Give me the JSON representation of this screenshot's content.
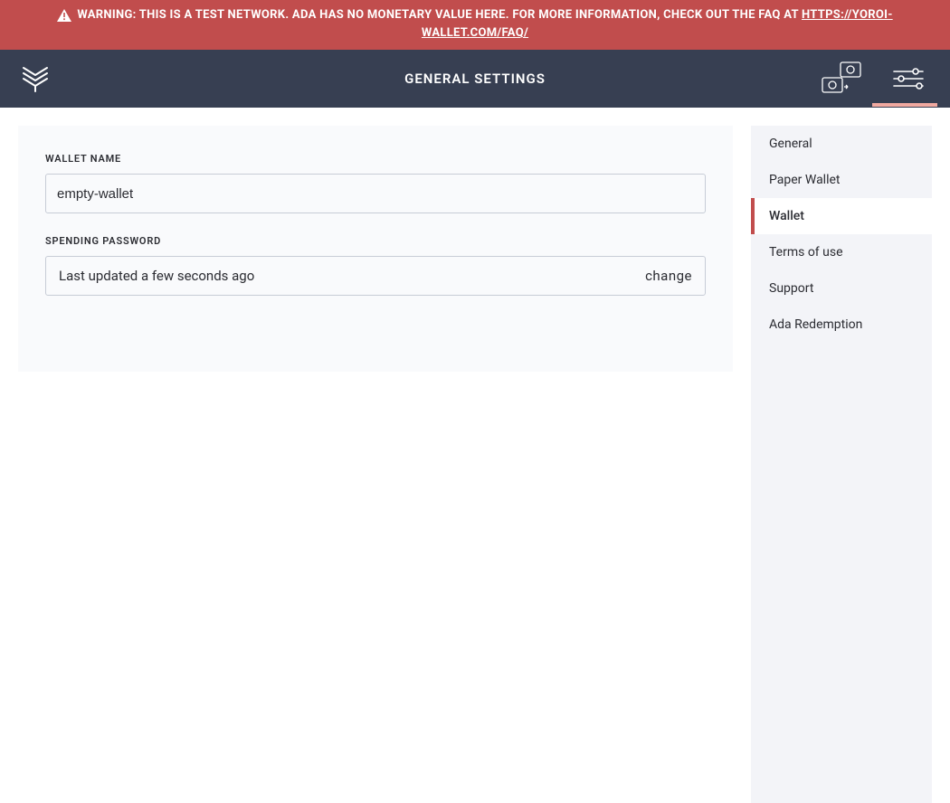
{
  "colors": {
    "banner_bg": "#c14d4d",
    "topbar_bg": "#373f52",
    "panel_bg": "#f9fafc",
    "sidenav_bg": "#f3f4f8",
    "border": "#c7ccd6",
    "accent_strip": "#f1a9a0"
  },
  "banner": {
    "text": "WARNING: THIS IS A TEST NETWORK. ADA HAS NO MONETARY VALUE HERE. FOR MORE INFORMATION, CHECK OUT THE FAQ AT ",
    "link_text": "HTTPS://YOROI-WALLET.COM/FAQ/"
  },
  "header": {
    "title": "GENERAL SETTINGS"
  },
  "form": {
    "wallet_name_label": "WALLET NAME",
    "wallet_name_value": "empty-wallet",
    "spending_password_label": "SPENDING PASSWORD",
    "spending_password_status": "Last updated a few seconds ago",
    "change_label": "change"
  },
  "sidenav": {
    "items": [
      {
        "label": "General"
      },
      {
        "label": "Paper Wallet"
      },
      {
        "label": "Wallet"
      },
      {
        "label": "Terms of use"
      },
      {
        "label": "Support"
      },
      {
        "label": "Ada Redemption"
      }
    ],
    "active_index": 2
  }
}
